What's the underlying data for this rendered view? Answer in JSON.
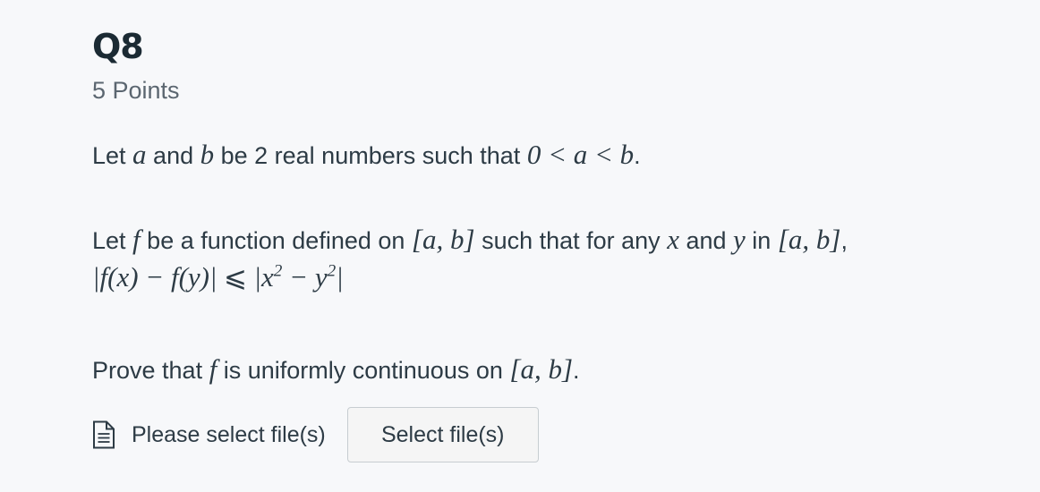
{
  "question": {
    "title": "Q8",
    "points": "5 Points"
  },
  "body": {
    "p1": {
      "t1": "Let ",
      "a": "a",
      "t2": " and ",
      "b": "b",
      "t3": " be 2 real numbers such that ",
      "ineq": "0 < a < b",
      "t4": "."
    },
    "p2": {
      "t1": "Let ",
      "f": "f",
      "t2": " be a function defined on ",
      "interval": "[a, b]",
      "t3": " such that for any ",
      "x": "x",
      "t4": " and ",
      "y": "y",
      "t5": " in ",
      "interval2": "[a, b]",
      "t6": ","
    },
    "p3": {
      "lhs": "|f(x) − f(y)|",
      "rel": "⩽",
      "rhs_open": "|x",
      "rhs_exp1": "2",
      "rhs_mid": " − y",
      "rhs_exp2": "2",
      "rhs_close": "|"
    },
    "p4": {
      "t1": "Prove that ",
      "f": "f",
      "t2": " is uniformly continuous on ",
      "interval": "[a, b]",
      "t3": "."
    }
  },
  "upload": {
    "icon": "document-icon",
    "label": "Please select file(s)",
    "button_label": "Select file(s)"
  }
}
